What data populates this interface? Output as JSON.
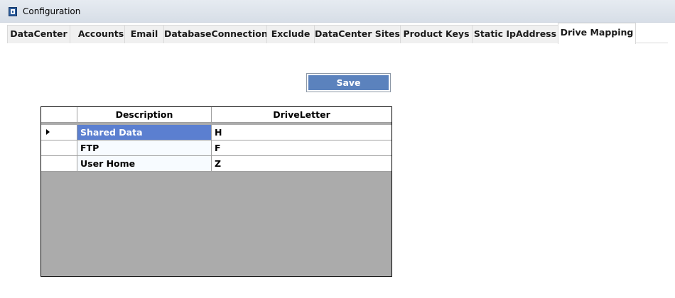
{
  "window": {
    "title": "Configuration",
    "icon": "app-config-icon"
  },
  "tabs": [
    {
      "label": "DataCenter",
      "active": false
    },
    {
      "label": "Accounts",
      "active": false
    },
    {
      "label": "Email",
      "active": false
    },
    {
      "label": "DatabaseConnection",
      "active": false
    },
    {
      "label": "Exclude",
      "active": false
    },
    {
      "label": "DataCenter Sites",
      "active": false
    },
    {
      "label": "Product Keys",
      "active": false
    },
    {
      "label": "Static IpAddress",
      "active": false
    },
    {
      "label": "Drive Mapping",
      "active": true
    }
  ],
  "toolbar": {
    "save_label": "Save"
  },
  "grid": {
    "columns": [
      "Description",
      "DriveLetter"
    ],
    "rows": [
      {
        "description": "Shared Data",
        "drive_letter": "H",
        "current": true,
        "selected": true
      },
      {
        "description": "FTP",
        "drive_letter": "F",
        "current": false,
        "selected": false
      },
      {
        "description": "User Home",
        "drive_letter": "Z",
        "current": false,
        "selected": false
      }
    ]
  },
  "colors": {
    "accent": "#5b82bd",
    "selection": "#5b7fd0",
    "grid_background": "#ababab"
  }
}
